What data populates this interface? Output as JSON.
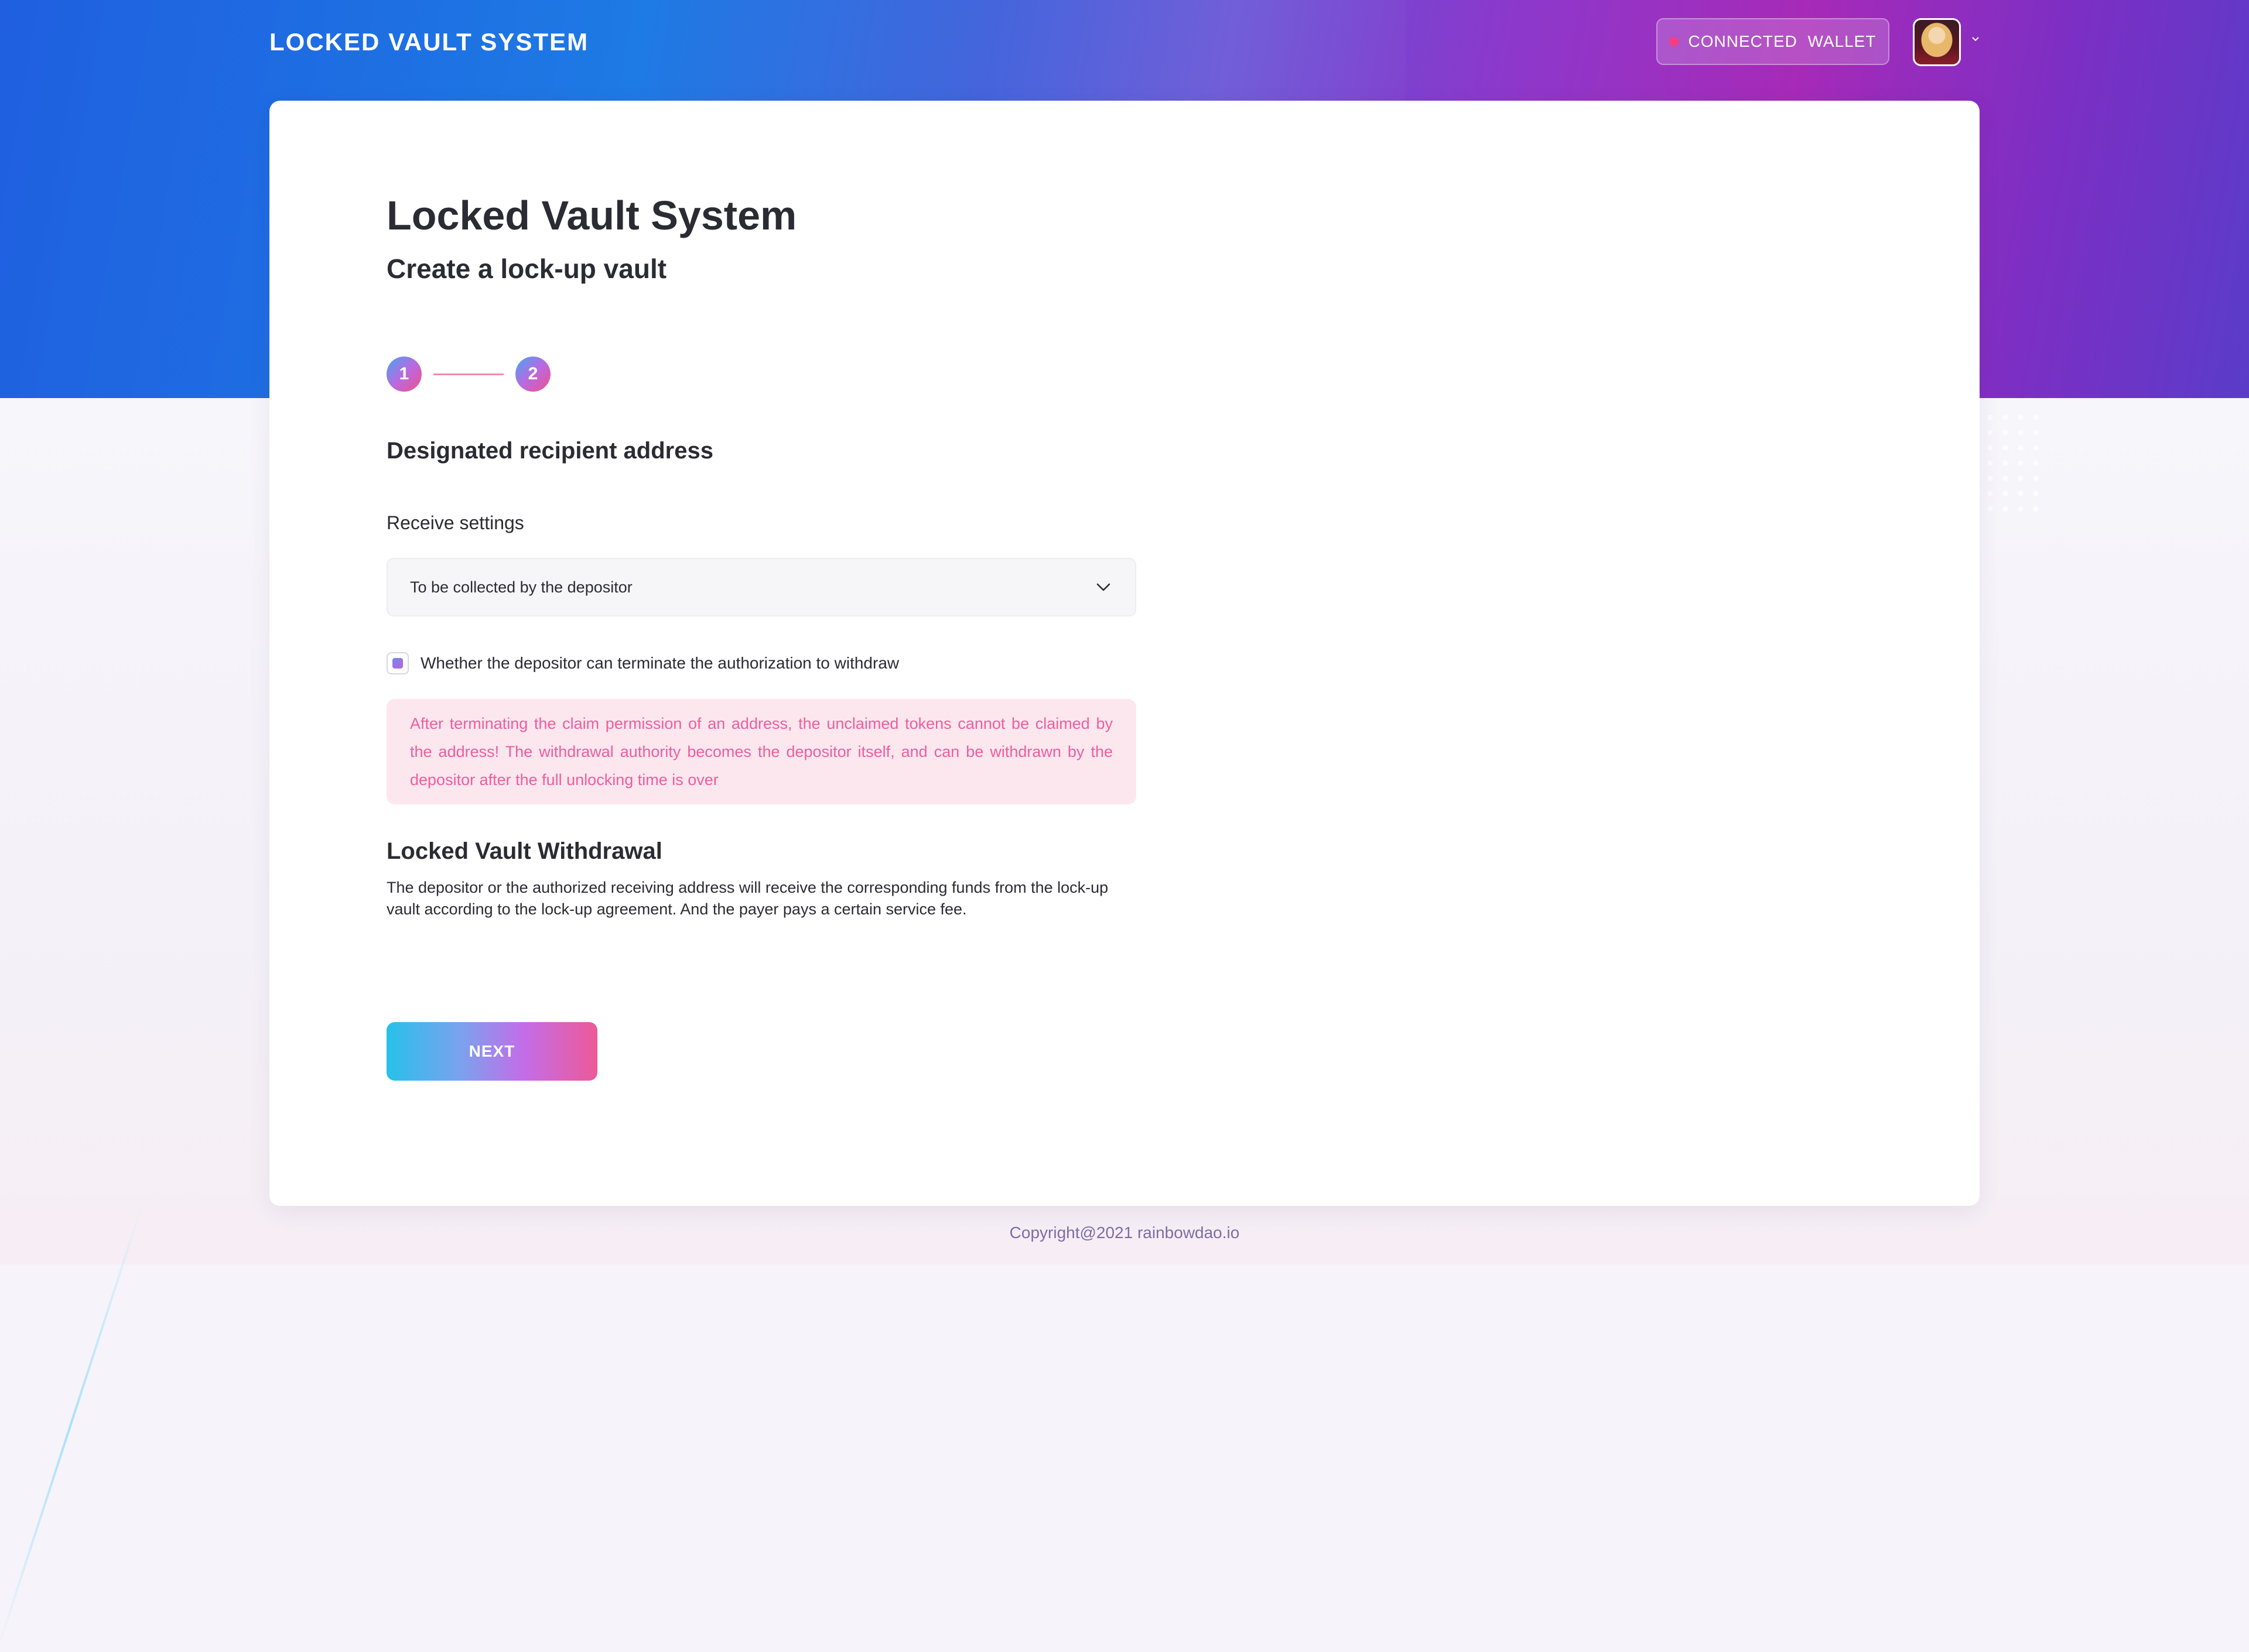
{
  "header": {
    "brand": "LOCKED VAULT SYSTEM",
    "wallet_button": "CONNECTED  WALLET",
    "wallet_status_color": "#ff3b7a"
  },
  "page": {
    "title": "Locked Vault System",
    "subtitle": "Create a lock-up vault"
  },
  "steps": {
    "items": [
      "1",
      "2"
    ]
  },
  "form": {
    "section_title": "Designated recipient address",
    "receive_label": "Receive settings",
    "receive_value": "To be collected by the depositor",
    "checkbox_label": "Whether the depositor can terminate the authorization to withdraw",
    "checkbox_checked": true,
    "warning": "After terminating the claim permission of an address, the unclaimed tokens cannot be claimed by the address! The withdrawal authority becomes the depositor itself, and can be withdrawn by the depositor after the full unlocking time is over"
  },
  "withdrawal": {
    "title": "Locked Vault Withdrawal",
    "description": "The depositor or the authorized receiving address will receive the corresponding funds from the lock-up vault according to the lock-up agreement. And the payer pays a certain service fee."
  },
  "actions": {
    "next_label": "NEXT"
  },
  "footer": {
    "copyright": "Copyright@2021 rainbowdao.io"
  },
  "icons": {
    "chevron": "chevron-down-icon",
    "avatar_caret": "caret-down-icon"
  },
  "colors": {
    "accent_pink": "#ef5d9b",
    "warning_bg": "#fde7ef",
    "step_line": "#f28ab4"
  }
}
